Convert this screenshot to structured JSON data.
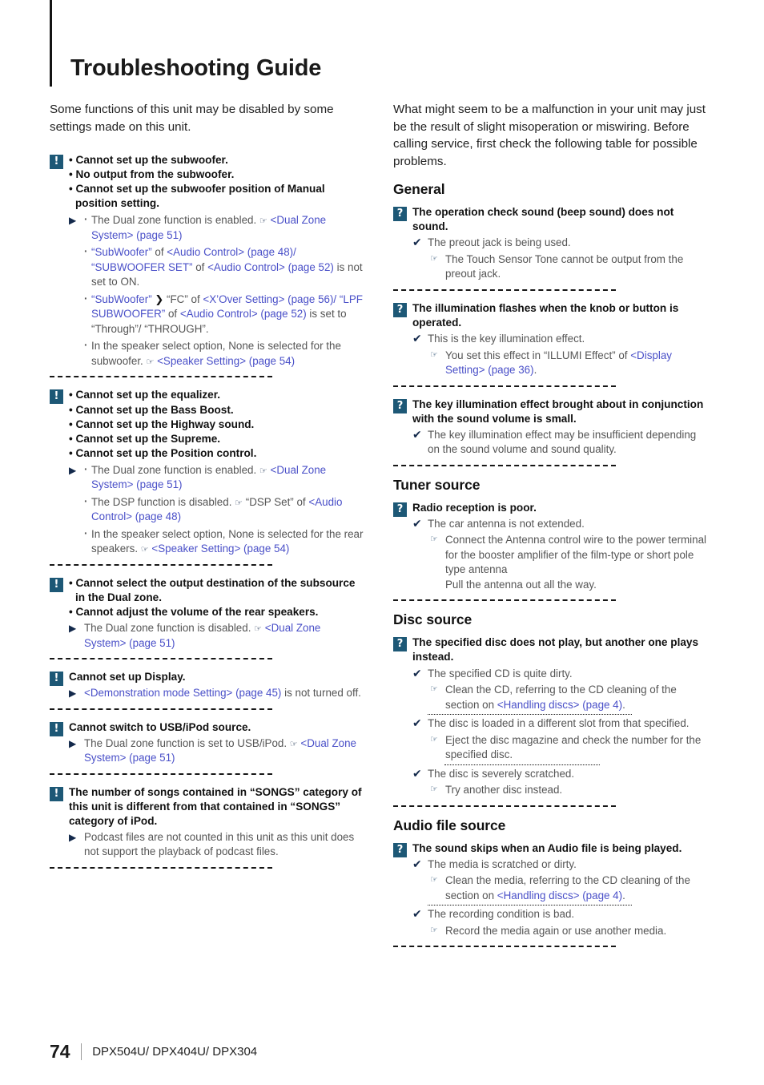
{
  "page": {
    "title": "Troubleshooting Guide",
    "footer": {
      "number": "74",
      "models": "DPX504U/ DPX404U/ DPX304"
    }
  },
  "icons": {
    "warning": "!",
    "question": "?",
    "triangle": "▶",
    "check": "✔",
    "hand": "☞",
    "chevron": "❯",
    "badge_color": "#1d5876",
    "link_color": "#4a50c8",
    "mark_color": "#13294b"
  },
  "left": {
    "intro": "Some functions of this unit may be disabled by some settings made on this unit.",
    "blocks": [
      {
        "badge": "!",
        "questions": [
          "• Cannot set up the subwoofer.",
          "• No output from the subwoofer.",
          "• Cannot set up the subwoofer position of Manual position setting."
        ],
        "answers": [
          {
            "mark": "triangle",
            "sub": true,
            "html": "The Dual zone function is enabled. <span class=\"mark-hand\">☞</span> <span class=\"ref\">&lt;Dual Zone System&gt; (page 51)</span>"
          },
          {
            "mark": "none",
            "sub": true,
            "html": "<span class=\"ref\">“SubWoofer”</span> of <span class=\"ref\">&lt;Audio Control&gt; (page 48)/</span> <span class=\"ref\">“SUBWOOFER SET”</span> of <span class=\"ref\">&lt;Audio Control&gt; (page 52)</span> is not set to ON."
          },
          {
            "mark": "none",
            "sub": true,
            "html": "<span class=\"ref\">“SubWoofer”</span> <span class=\"chev\">❯</span> “FC” of <span class=\"ref\">&lt;X’Over Setting&gt; (page 56)/</span> <span class=\"ref\">“LPF SUBWOOFER”</span> of <span class=\"ref\">&lt;Audio Control&gt; (page 52)</span> is set to “Through”/ “THROUGH”."
          },
          {
            "mark": "none",
            "sub": true,
            "html": "In the speaker select option, None is selected for the subwoofer. <span class=\"mark-hand\">☞</span> <span class=\"ref\">&lt;Speaker Setting&gt; (page 54)</span>"
          }
        ]
      },
      {
        "badge": "!",
        "questions": [
          "• Cannot set up the equalizer.",
          "• Cannot set up the Bass Boost.",
          "• Cannot set up the Highway sound.",
          "• Cannot set up the Supreme.",
          "• Cannot set up the Position control."
        ],
        "answers": [
          {
            "mark": "triangle",
            "sub": true,
            "html": "The Dual zone function is enabled. <span class=\"mark-hand\">☞</span> <span class=\"ref\">&lt;Dual Zone System&gt; (page 51)</span>"
          },
          {
            "mark": "none",
            "sub": true,
            "html": "The DSP function is disabled. <span class=\"mark-hand\">☞</span> “DSP Set” of <span class=\"ref\">&lt;Audio Control&gt; (page 48)</span>"
          },
          {
            "mark": "none",
            "sub": true,
            "html": "In the speaker select option, None is selected for the rear speakers. <span class=\"mark-hand\">☞</span> <span class=\"ref\">&lt;Speaker Setting&gt; (page 54)</span>"
          }
        ]
      },
      {
        "badge": "!",
        "questions": [
          "• Cannot select the output destination of the subsource in the Dual zone.",
          "• Cannot adjust the volume of the rear speakers."
        ],
        "answers": [
          {
            "mark": "triangle",
            "sub": false,
            "html": "The Dual zone function is disabled. <span class=\"mark-hand\">☞</span> <span class=\"ref\">&lt;Dual Zone System&gt; (page 51)</span>"
          }
        ]
      },
      {
        "badge": "!",
        "questions": [
          "Cannot set up Display."
        ],
        "answers": [
          {
            "mark": "triangle",
            "sub": false,
            "html": "<span class=\"ref\">&lt;Demonstration mode Setting&gt; (page 45)</span> is not turned off."
          }
        ]
      },
      {
        "badge": "!",
        "questions": [
          "Cannot switch to USB/iPod source."
        ],
        "answers": [
          {
            "mark": "triangle",
            "sub": false,
            "html": "The Dual zone function is set to USB/iPod. <span class=\"mark-hand\">☞</span> <span class=\"ref\">&lt;Dual Zone System&gt; (page 51)</span>"
          }
        ]
      },
      {
        "badge": "!",
        "questions": [
          "The number of songs contained in “SONGS” category of this unit is different from that contained in “SONGS” category of iPod."
        ],
        "answers": [
          {
            "mark": "triangle",
            "sub": false,
            "html": "Podcast files are not counted in this unit as this unit does not support the playback of podcast files."
          }
        ]
      }
    ]
  },
  "right": {
    "intro": "What might seem to be a malfunction in your unit may just be the result of slight misoperation or miswiring. Before calling service, first check the following table for possible problems.",
    "sections": [
      {
        "heading": "General",
        "blocks": [
          {
            "badge": "?",
            "questions": [
              "The operation check sound (beep sound) does not sound."
            ],
            "answers": [
              {
                "mark": "check",
                "html": "The preout jack is being used."
              },
              {
                "mark": "hand",
                "deep": true,
                "html": "The Touch Sensor Tone cannot be output from the preout jack."
              }
            ]
          },
          {
            "badge": "?",
            "questions": [
              "The illumination flashes when the knob or button is operated."
            ],
            "answers": [
              {
                "mark": "check",
                "html": "This is the key illumination effect."
              },
              {
                "mark": "hand",
                "deep": true,
                "html": "You set this effect in “ILLUMI Effect” of <span class=\"ref\">&lt;Display Setting&gt; (page 36)</span>."
              }
            ]
          },
          {
            "badge": "?",
            "questions": [
              "The key illumination effect brought about in conjunction with the sound volume is small."
            ],
            "answers": [
              {
                "mark": "check",
                "html": "The key illumination effect may be insufficient depending on the sound volume and sound quality."
              }
            ]
          }
        ]
      },
      {
        "heading": "Tuner source",
        "blocks": [
          {
            "badge": "?",
            "questions": [
              "Radio reception is poor."
            ],
            "answers": [
              {
                "mark": "check",
                "html": "The car antenna is not extended."
              },
              {
                "mark": "hand",
                "deep": true,
                "html": "Connect the Antenna control wire to the power terminal for the booster amplifier of the film-type or short pole type antenna<br>Pull the antenna out all the way."
              }
            ]
          }
        ]
      },
      {
        "heading": "Disc source",
        "blocks": [
          {
            "badge": "?",
            "questions": [
              "The specified disc does not play, but another one plays instead."
            ],
            "answers": [
              {
                "mark": "check",
                "html": "The specified CD is quite dirty."
              },
              {
                "mark": "hand",
                "deep": true,
                "html": "Clean the CD, referring to the CD cleaning of the section on <span class=\"ref\">&lt;Handling discs&gt; (page 4)</span>."
              },
              {
                "dot": true
              },
              {
                "mark": "check",
                "html": "The disc is loaded in a different slot from that specified."
              },
              {
                "mark": "hand",
                "deep": true,
                "html": "Eject the disc magazine and check the number for the specified disc."
              },
              {
                "dot": true,
                "narrow": true
              },
              {
                "mark": "check",
                "html": "The disc is severely scratched."
              },
              {
                "mark": "hand",
                "deep": true,
                "html": "Try another disc instead."
              }
            ]
          }
        ]
      },
      {
        "heading": "Audio file source",
        "blocks": [
          {
            "badge": "?",
            "questions": [
              "The sound skips when an Audio file is being played."
            ],
            "answers": [
              {
                "mark": "check",
                "html": "The media is scratched or dirty."
              },
              {
                "mark": "hand",
                "deep": true,
                "html": "Clean the media, referring to the CD cleaning of the section on <span class=\"ref\">&lt;Handling discs&gt; (page 4)</span>."
              },
              {
                "dot": true
              },
              {
                "mark": "check",
                "html": "The recording condition is bad."
              },
              {
                "mark": "hand",
                "deep": true,
                "html": "Record the media again or use another media."
              }
            ]
          }
        ]
      }
    ]
  }
}
